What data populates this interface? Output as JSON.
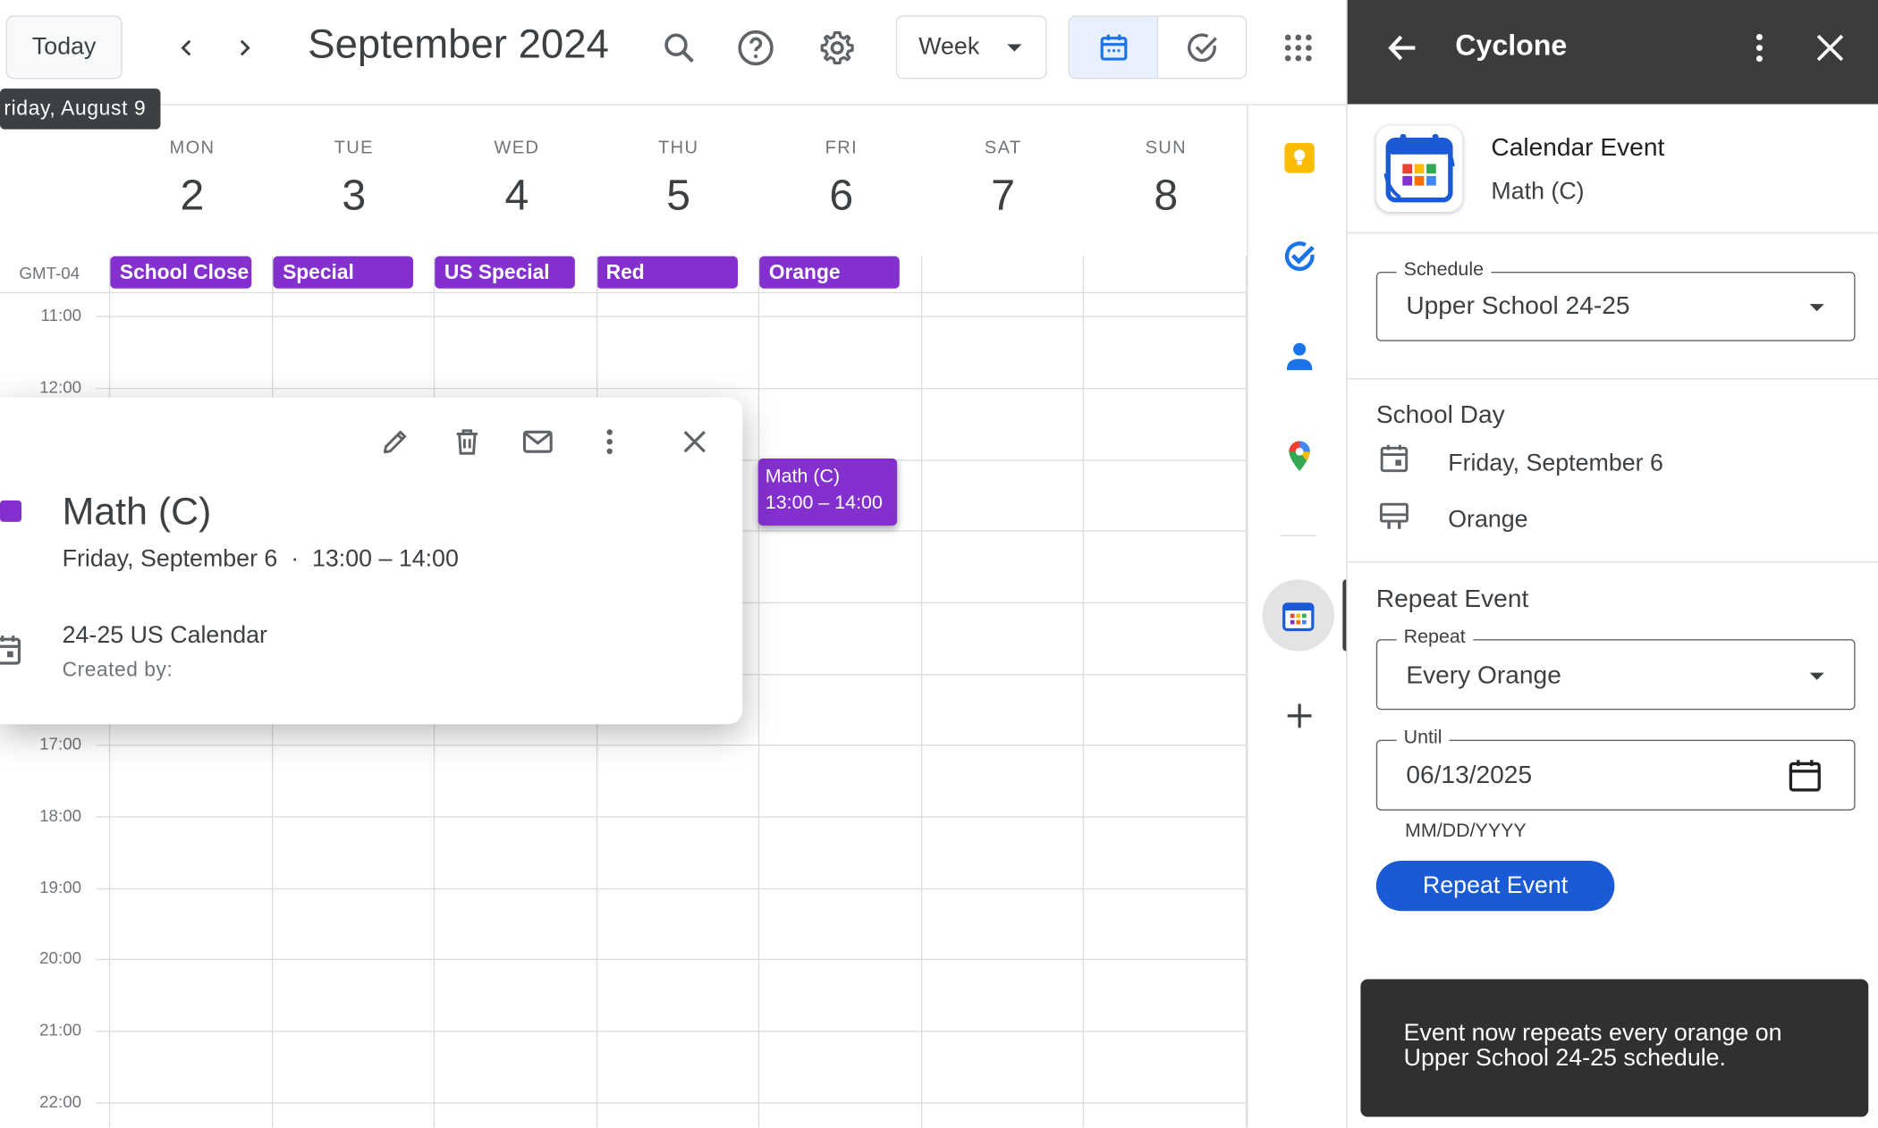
{
  "toolbar": {
    "today_label": "Today",
    "month_title": "September 2024",
    "view_label": "Week",
    "tooltip": "riday, August 9"
  },
  "calendar": {
    "timezone": "GMT-04",
    "days": [
      {
        "name": "MON",
        "num": "2"
      },
      {
        "name": "TUE",
        "num": "3"
      },
      {
        "name": "WED",
        "num": "4"
      },
      {
        "name": "THU",
        "num": "5"
      },
      {
        "name": "FRI",
        "num": "6"
      },
      {
        "name": "SAT",
        "num": "7"
      },
      {
        "name": "SUN",
        "num": "8"
      }
    ],
    "allday": [
      "School Close",
      "Special",
      "US Special",
      "Red",
      "Orange"
    ],
    "times": [
      "11:00",
      "12:00",
      "17:00",
      "18:00",
      "19:00",
      "20:00",
      "21:00",
      "22:00"
    ],
    "event": {
      "title": "Math (C)",
      "time": "13:00 – 14:00"
    }
  },
  "popup": {
    "title": "Math (C)",
    "datetime": "Friday, September 6  ·  13:00 – 14:00",
    "calendar": "24-25 US Calendar",
    "created_by": "Created by:"
  },
  "panel": {
    "title": "Cyclone",
    "event_type": "Calendar Event",
    "event_name": "Math (C)",
    "schedule_label": "Schedule",
    "schedule_value": "Upper School 24-25",
    "school_day_heading": "School Day",
    "school_day_date": "Friday, September 6",
    "school_day_color": "Orange",
    "repeat_heading": "Repeat Event",
    "repeat_label": "Repeat",
    "repeat_value": "Every Orange",
    "until_label": "Until",
    "until_value": "06/13/2025",
    "date_format_hint": "MM/DD/YYYY",
    "repeat_button": "Repeat Event"
  },
  "toast": {
    "message": "Event now repeats every orange on Upper School 24-25 schedule."
  },
  "colors": {
    "event_purple": "#8430ce",
    "primary_blue": "#1a5ad7",
    "panel_header": "#3c3c3c"
  }
}
